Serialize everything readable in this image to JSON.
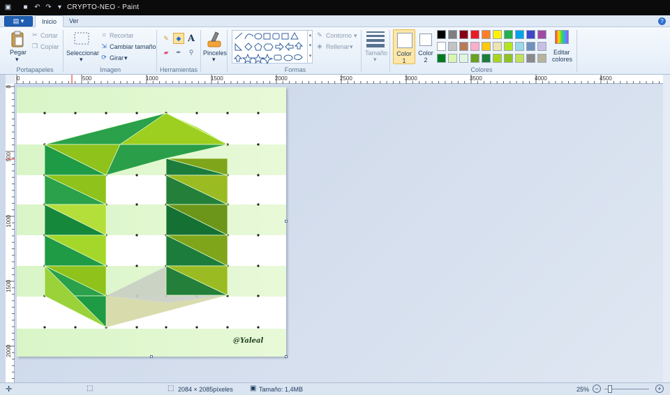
{
  "window": {
    "title": "CRYPTO-NEO - Paint"
  },
  "tabs": [
    {
      "label": "Inicio"
    },
    {
      "label": "Ver"
    }
  ],
  "ribbon": {
    "portapapeles": {
      "pegar": "Pegar",
      "cortar": "Cortar",
      "copiar": "Copiar",
      "group": "Portapapeles"
    },
    "imagen": {
      "seleccionar": "Seleccionar",
      "recortar": "Recortar",
      "cambiar": "Cambiar tamaño",
      "girar": "Girar",
      "group": "Imagen"
    },
    "herramientas": {
      "group": "Herramientas"
    },
    "pinceles": "Pinceles",
    "formas": {
      "contorno": "Contorno",
      "rellenar": "Rellenar",
      "group": "Formas"
    },
    "tamano": "Tamaño",
    "color1": {
      "label": "Color",
      "num": "1"
    },
    "color2": {
      "label": "Color",
      "num": "2"
    },
    "colores": {
      "group": "Colores",
      "editar1": "Editar",
      "editar2": "colores"
    }
  },
  "palette": [
    "#000000",
    "#7f7f7f",
    "#880015",
    "#ed1c24",
    "#ff7f27",
    "#fff200",
    "#22b14c",
    "#00a2e8",
    "#3f48cc",
    "#a349a4",
    "#ffffff",
    "#c3c3c3",
    "#b97a57",
    "#ffaec9",
    "#ffc90e",
    "#efe4b0",
    "#b5e61d",
    "#99d9ea",
    "#7092be",
    "#c8bfe7",
    "#007a1e",
    "#d9f5b0",
    "#dff5e0",
    "#6aa11e",
    "#1b7c3c",
    "#a8d61f",
    "#8fc31f",
    "#c4e05a",
    "#8a8a8a",
    "#b8b39a"
  ],
  "ruler": {
    "h": [
      "0",
      "500",
      "1000",
      "1500",
      "2000",
      "2500",
      "3000",
      "3500",
      "4000",
      "4500"
    ],
    "v": [
      "0",
      "500",
      "1000",
      "1500",
      "2000"
    ]
  },
  "canvas": {
    "signature": "@Yaleal"
  },
  "status": {
    "dimensions": "2084 × 2085píxeles",
    "size": "Tamaño: 1,4MB",
    "zoom": "25%"
  }
}
